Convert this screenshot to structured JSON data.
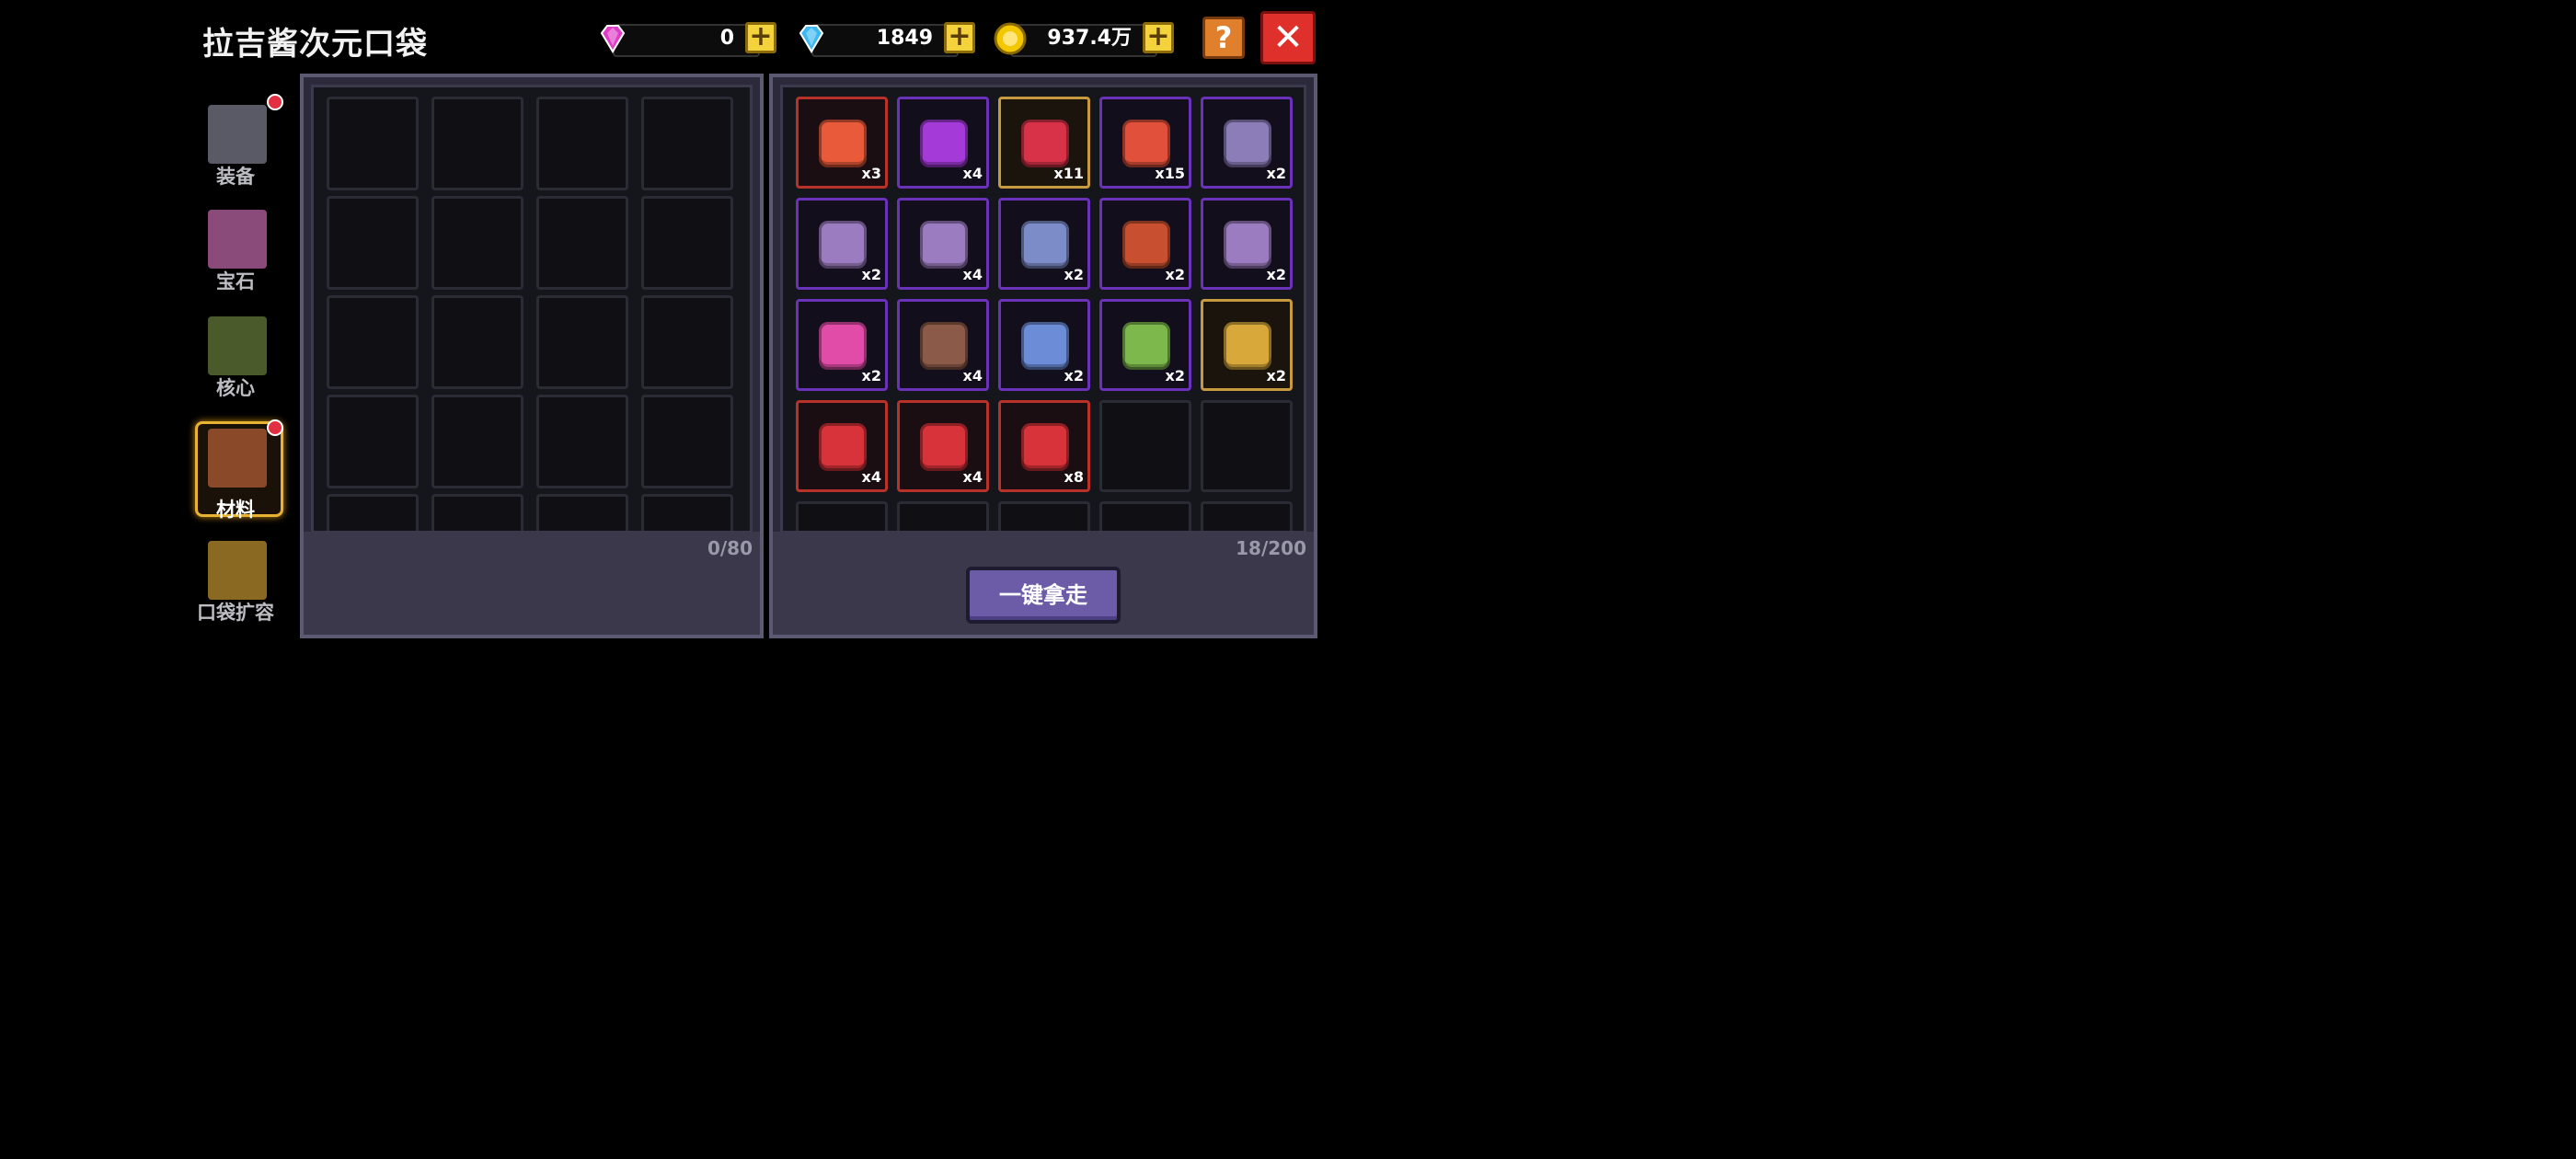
{
  "title": "拉吉酱次元口袋",
  "currencies": [
    {
      "icon": "pink-gem-icon",
      "value": "0",
      "color": "#e03cc8"
    },
    {
      "icon": "blue-gem-icon",
      "value": "1849",
      "color": "#3cb8f0"
    },
    {
      "icon": "gold-coin-icon",
      "value": "937.4万",
      "color": "#f4c800"
    }
  ],
  "buttons": {
    "help": "?",
    "close": "✕",
    "take_all": "一键拿走",
    "plus": "+"
  },
  "sidebar": [
    {
      "label": "装备",
      "icon": "equipment-icon",
      "dot": true,
      "active": false
    },
    {
      "label": "宝石",
      "icon": "gem-icon",
      "dot": false,
      "active": false
    },
    {
      "label": "核心",
      "icon": "core-icon",
      "dot": false,
      "active": false
    },
    {
      "label": "材料",
      "icon": "material-icon",
      "dot": true,
      "active": true
    },
    {
      "label": "口袋扩容",
      "icon": "expand-pocket-icon",
      "dot": false,
      "active": false
    }
  ],
  "left_panel": {
    "count": "0/80"
  },
  "right_panel": {
    "count": "18/200"
  },
  "items": [
    {
      "qty": "x3",
      "rarity": "r",
      "icon": "fire-crystal-icon",
      "color": "#e85a3a"
    },
    {
      "qty": "x4",
      "rarity": "p",
      "icon": "purple-orb-icon",
      "color": "#a43ad8"
    },
    {
      "qty": "x11",
      "rarity": "g",
      "icon": "red-crystal-icon",
      "color": "#d83248"
    },
    {
      "qty": "x15",
      "rarity": "p",
      "icon": "red-token-icon",
      "color": "#e0503a"
    },
    {
      "qty": "x2",
      "rarity": "p",
      "icon": "grey-ring-icon",
      "color": "#8c7cb8"
    },
    {
      "qty": "x2",
      "rarity": "p",
      "icon": "gold-emblem-icon",
      "color": "#9c7cc0"
    },
    {
      "qty": "x4",
      "rarity": "p",
      "icon": "horn-icon",
      "color": "#9c7cc0"
    },
    {
      "qty": "x2",
      "rarity": "p",
      "icon": "tablet-icon",
      "color": "#7c8cc8"
    },
    {
      "qty": "x2",
      "rarity": "p",
      "icon": "red-bowl-icon",
      "color": "#c85030"
    },
    {
      "qty": "x2",
      "rarity": "p",
      "icon": "blade-icon",
      "color": "#9c7cc0"
    },
    {
      "qty": "x2",
      "rarity": "p",
      "icon": "pink-creature-icon",
      "color": "#e04ca8"
    },
    {
      "qty": "x4",
      "rarity": "p",
      "icon": "brown-gun-icon",
      "color": "#8c5a48"
    },
    {
      "qty": "x2",
      "rarity": "p",
      "icon": "blue-staff-icon",
      "color": "#6c8cd8"
    },
    {
      "qty": "x2",
      "rarity": "p",
      "icon": "cactus-icon",
      "color": "#7cb84c"
    },
    {
      "qty": "x2",
      "rarity": "g",
      "icon": "green-scroll-icon",
      "color": "#d8a83a"
    },
    {
      "qty": "x4",
      "rarity": "r",
      "icon": "axe-icon",
      "color": "#d8323a"
    },
    {
      "qty": "x4",
      "rarity": "r",
      "icon": "hook-icon",
      "color": "#d8323a"
    },
    {
      "qty": "x8",
      "rarity": "r",
      "icon": "green-gun-icon",
      "color": "#d8323a"
    }
  ]
}
